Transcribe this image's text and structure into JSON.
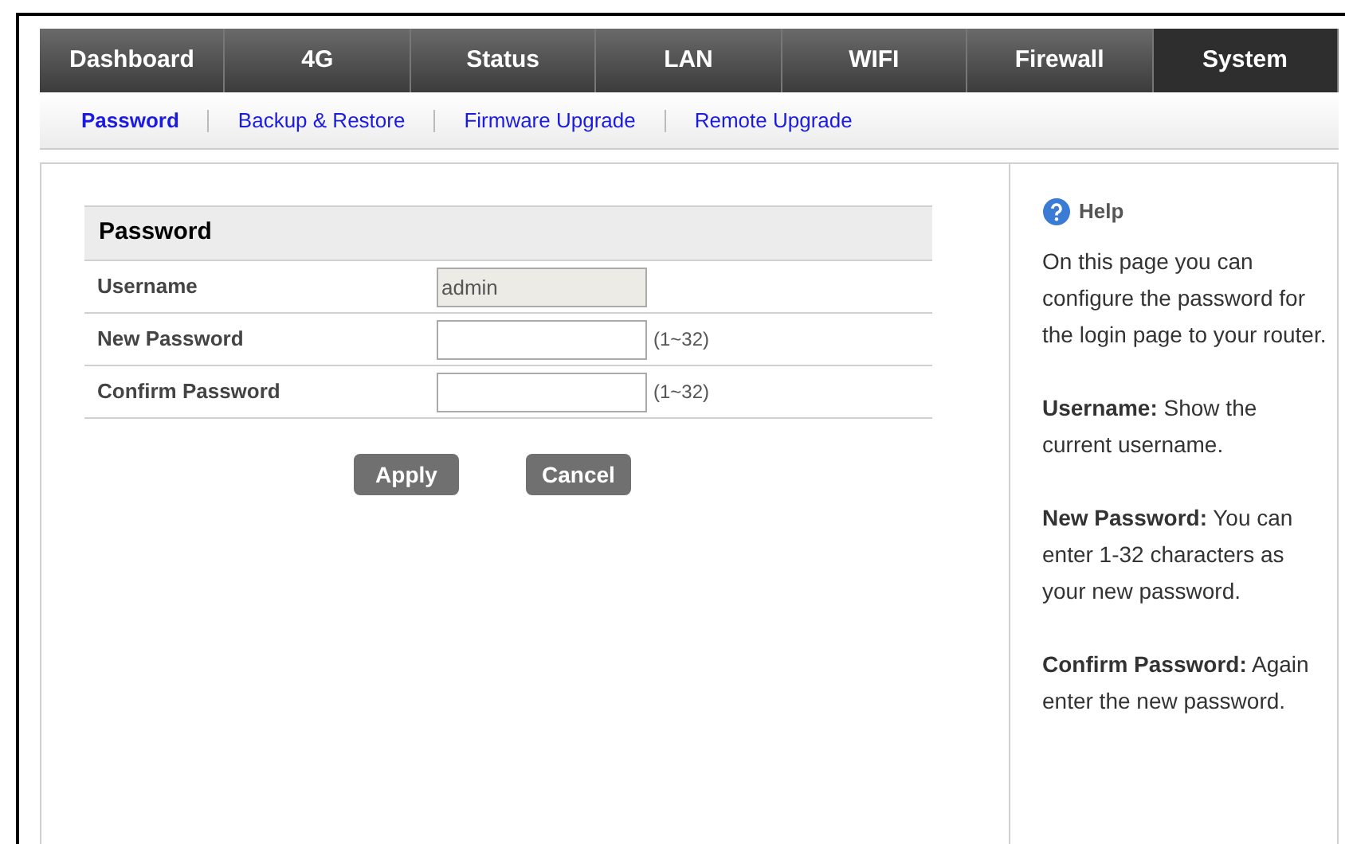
{
  "nav_tabs": [
    {
      "label": "Dashboard",
      "selected": false
    },
    {
      "label": "4G",
      "selected": false
    },
    {
      "label": "Status",
      "selected": false
    },
    {
      "label": "LAN",
      "selected": false
    },
    {
      "label": "WIFI",
      "selected": false
    },
    {
      "label": "Firewall",
      "selected": false
    },
    {
      "label": "System",
      "selected": true
    }
  ],
  "sub_tabs": [
    {
      "label": "Password",
      "selected": true
    },
    {
      "label": "Backup & Restore",
      "selected": false
    },
    {
      "label": "Firmware Upgrade",
      "selected": false
    },
    {
      "label": "Remote Upgrade",
      "selected": false
    }
  ],
  "form": {
    "title": "Password",
    "rows": [
      {
        "label": "Username",
        "value": "admin",
        "disabled": true
      },
      {
        "label": "New Password",
        "value": "",
        "hint": "(1~32)",
        "disabled": false
      },
      {
        "label": "Confirm Password",
        "value": "",
        "hint": "(1~32)",
        "disabled": false
      }
    ],
    "buttons": [
      "Apply",
      "Cancel"
    ]
  },
  "help": {
    "title": "Help",
    "paragraphs": [
      "On this page you can configure the password for the login page to your router.",
      "**Username:** Show the current username.",
      "**New Password:** You can enter 1-32 characters as your new password.",
      "**Confirm Password:** Again enter the new password."
    ]
  }
}
